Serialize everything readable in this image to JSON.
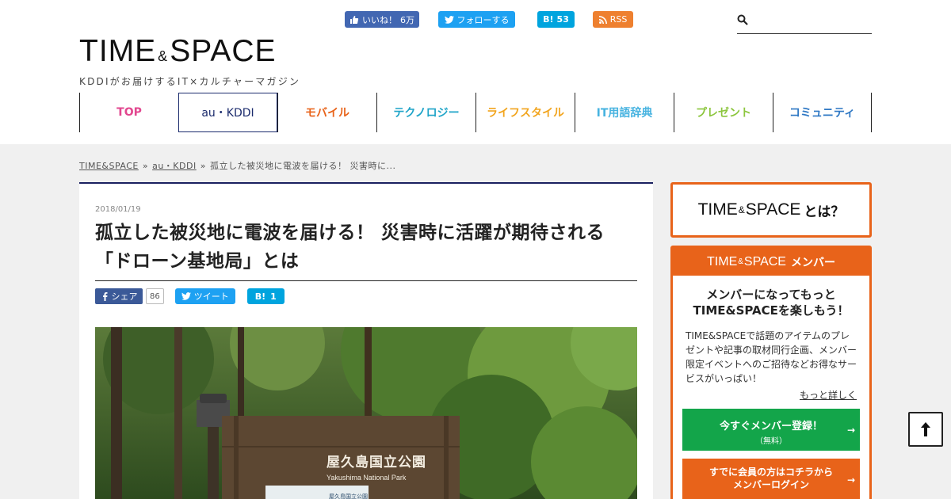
{
  "social": {
    "facebook": {
      "label": "いいね！",
      "count": "6万",
      "icon": "facebook-like-icon"
    },
    "twitter": {
      "label": "フォローする",
      "icon": "twitter-bird-icon"
    },
    "hatena": {
      "label": "B!",
      "count": "53",
      "icon": "hatena-bookmark-icon"
    },
    "rss": {
      "label": "RSS",
      "icon": "rss-icon"
    }
  },
  "logo": {
    "main_left": "TIME",
    "amp": "&",
    "main_right": "SPACE",
    "tagline": "KDDIがお届けするIT×カルチャーマガジン"
  },
  "search": {
    "placeholder": "",
    "icon": "search-icon"
  },
  "nav": [
    {
      "label": "TOP",
      "color": "#e2478f"
    },
    {
      "label": "au・KDDI",
      "color": "#1a2a6c"
    },
    {
      "label": "モバイル",
      "color": "#e8631a"
    },
    {
      "label": "テクノロジー",
      "color": "#1fa4c8"
    },
    {
      "label": "ライフスタイル",
      "color": "#f2a51f"
    },
    {
      "label": "IT用語辞典",
      "color": "#47b3e0"
    },
    {
      "label": "プレゼント",
      "color": "#8cc63e"
    },
    {
      "label": "コミュニティ",
      "color": "#2f78c4"
    }
  ],
  "breadcrumb": {
    "items": [
      "TIME&SPACE",
      "au・KDDI"
    ],
    "separator": "»",
    "current": "孤立した被災地に電波を届ける！ 災害時に..."
  },
  "article": {
    "date": "2018/01/19",
    "title_line1": "孤立した被災地に電波を届ける！ 災害時に活躍が期待される",
    "title_line2": "「ドローン基地局」とは",
    "share": {
      "fb_label": "シェア",
      "fb_count": "86",
      "tw_label": "ツイート",
      "hb_label": "B!",
      "hb_count": "1"
    },
    "hero": {
      "sign_text_jp": "屋久島国立公園",
      "sign_text_en": "Yakushima National Park",
      "board_title": "屋久島国立公園"
    }
  },
  "sidebar": {
    "about": {
      "left": "TIME",
      "amp": "&",
      "right": "SPACE",
      "suffix": "とは？"
    },
    "member": {
      "head_left": "TIME",
      "head_amp": "&",
      "head_right": "SPACE",
      "head_suffix": "メンバー",
      "lead_line1": "メンバーになってもっと",
      "lead_line2": "TIME&SPACEを楽しもう！",
      "description": "TIME&SPACEで話題のアイテムのプレゼントや記事の取材同行企画、メンバー限定イベントへのご招待などお得なサービスがいっぱい！",
      "more_link": "もっと詳しく",
      "register_label": "今すぐメンバー登録！",
      "register_sub": "（無料）",
      "login_line1": "すでに会員の方はコチラから",
      "login_line2": "メンバーログイン"
    }
  },
  "to_top": {
    "icon": "arrow-up-icon"
  },
  "colors": {
    "accent": "#e8631a",
    "navy": "#1a2060",
    "green": "#13a54a"
  }
}
